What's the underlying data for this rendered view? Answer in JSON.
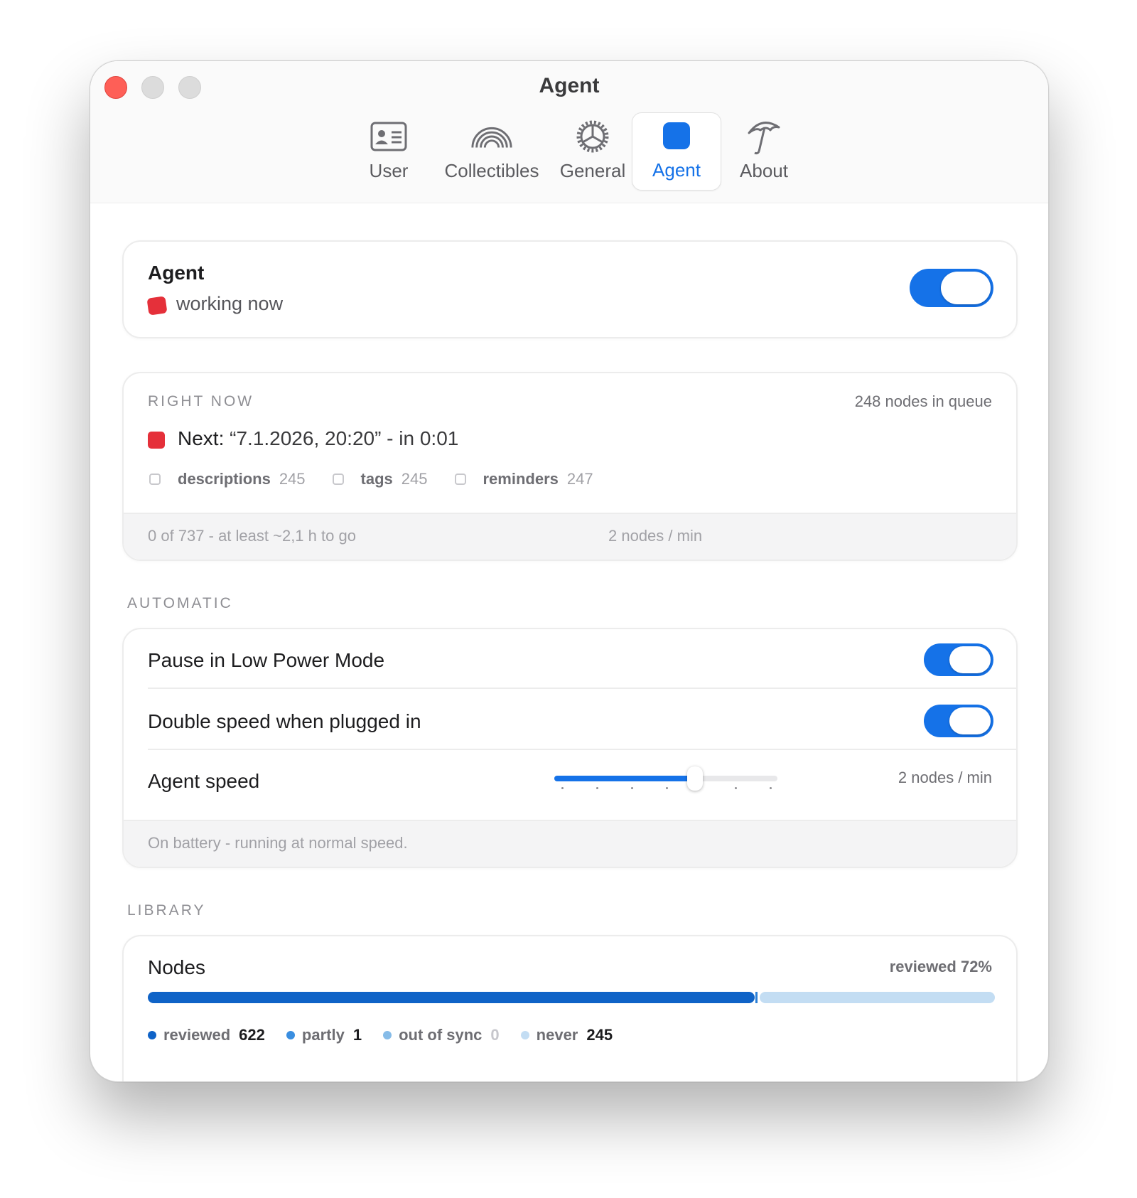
{
  "window": {
    "title": "Agent"
  },
  "tabs": [
    {
      "label": "User",
      "icon": "id-card-icon"
    },
    {
      "label": "Collectibles",
      "icon": "rainbow-icon"
    },
    {
      "label": "General",
      "icon": "gear-icon"
    },
    {
      "label": "Agent",
      "icon": "blue-square-icon",
      "active": true
    },
    {
      "label": "About",
      "icon": "umbrella-icon"
    }
  ],
  "agent_card": {
    "title": "Agent",
    "status": "working now",
    "enabled": true
  },
  "right_now": {
    "section_label": "RIGHT NOW",
    "queue": "248 nodes in queue",
    "next_label": "Next:",
    "next_value": " “7.1.2026, 20:20” - in 0:01",
    "stats": [
      {
        "name": "descriptions",
        "value": "245"
      },
      {
        "name": "tags",
        "value": "245"
      },
      {
        "name": "reminders",
        "value": "247"
      }
    ],
    "progress_text": "0 of 737 - at least ~2,1 h to go",
    "rate_text": "2 nodes / min"
  },
  "automatic": {
    "section_label": "AUTOMATIC",
    "pause_label": "Pause in Low Power Mode",
    "pause_on": true,
    "double_label": "Double speed when plugged in",
    "double_on": true,
    "speed_label": "Agent speed",
    "speed_fraction": 0.63,
    "speed_value": "2 nodes / min",
    "footer": "On battery - running at normal speed."
  },
  "library": {
    "section_label": "LIBRARY",
    "nodes_title": "Nodes",
    "reviewed_pct": "reviewed 72%",
    "legend": [
      {
        "name": "reviewed",
        "value": "622",
        "color": "#0f63c7"
      },
      {
        "name": "partly",
        "value": "1",
        "color": "#3a8ee0"
      },
      {
        "name": "out of sync",
        "value": "0",
        "color": "#86bce8"
      },
      {
        "name": "never",
        "value": "245",
        "color": "#c3ddf3"
      }
    ]
  },
  "colors": {
    "accent": "#1572e8",
    "status_red": "#e5303a"
  }
}
